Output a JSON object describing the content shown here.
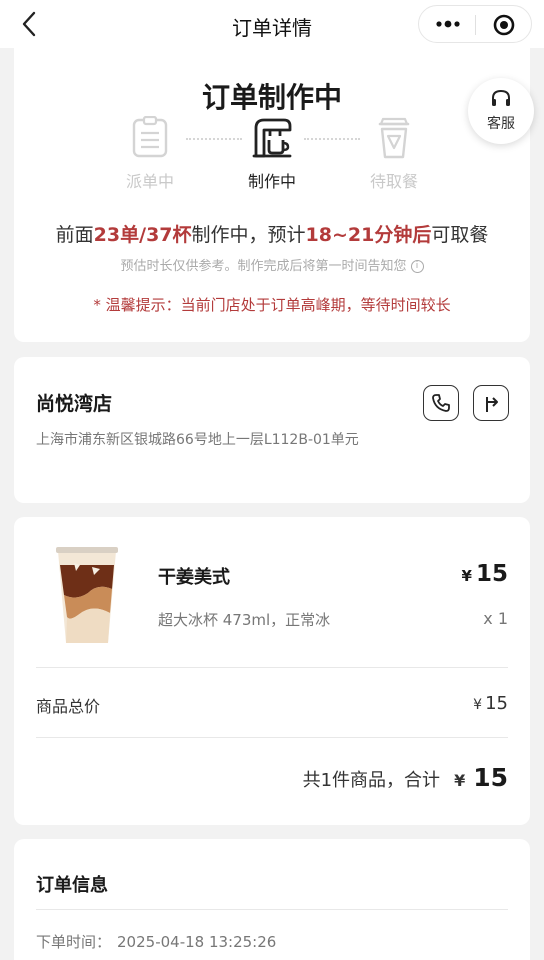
{
  "nav": {
    "title": "订单详情"
  },
  "status": {
    "title": "订单制作中",
    "steps": [
      {
        "label": "派单中",
        "state": "done"
      },
      {
        "label": "制作中",
        "state": "active"
      },
      {
        "label": "待取餐",
        "state": "pending"
      }
    ],
    "queue": {
      "prefix": "前面",
      "orders": "23单",
      "slash": "/",
      "cups": "37杯",
      "middle": "制作中，预计",
      "time": "18~21分钟后",
      "suffix": "可取餐"
    },
    "estimate_note": "预估时长仅供参考。制作完成后将第一时间告知您",
    "tip": "* 温馨提示：当前门店处于订单高峰期，等待时间较长",
    "accent_color": "#b33b3b"
  },
  "service": {
    "label": "客服"
  },
  "store": {
    "name": "尚悦湾店",
    "address": "上海市浦东新区银城路66号地上一层L112B-01单元"
  },
  "product": {
    "name": "干姜美式",
    "currency": "¥",
    "price": "15",
    "spec": "超大冰杯 473ml，正常冰",
    "qty": "x 1"
  },
  "summary": {
    "subtotal_label": "商品总价",
    "subtotal_currency": "¥",
    "subtotal_value": "15",
    "total_label": "共1件商品，合计",
    "total_currency": "¥",
    "total_value": "15"
  },
  "order_info": {
    "title": "订单信息",
    "time_label": "下单时间：",
    "time_value": "2025-04-18 13:25:26"
  }
}
